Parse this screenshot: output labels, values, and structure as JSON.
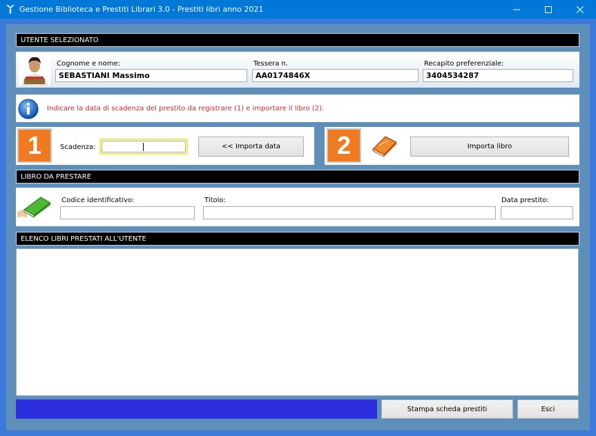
{
  "window": {
    "title": "Gestione Biblioteca e Prestiti Librari 3.0 - Prestiti libri anno 2021"
  },
  "user_section": {
    "header": "UTENTE SELEZIONATO",
    "name_label": "Cognome e nome:",
    "name_value": "SEBASTIANI Massimo",
    "card_label": "Tessera n.",
    "card_value": "AA0174846X",
    "contact_label": "Recapito preferenziale:",
    "contact_value": "3404534287"
  },
  "info": {
    "message": "Indicare la data di scadenza del prestito da registrare (1) e importare il libro (2)."
  },
  "step1": {
    "number": "1",
    "deadline_label": "Scadenza:",
    "deadline_value": "",
    "import_date_button": "<<  Importa data"
  },
  "step2": {
    "number": "2",
    "import_book_button": "Importa libro"
  },
  "book_section": {
    "header": "LIBRO DA PRESTARE",
    "code_label": "Codice identificativo:",
    "code_value": "",
    "title_label": "Titolo:",
    "title_value": "",
    "date_label": "Data prestito:",
    "date_value": ""
  },
  "loans_section": {
    "header": "ELENCO LIBRI PRESTATI ALL'UTENTE"
  },
  "footer": {
    "print_button": "Stampa scheda prestiti",
    "exit_button": "Esci"
  },
  "colors": {
    "titlebar": "#0078d7",
    "panel_bg": "#5d8fba",
    "accent_orange": "#f07a22",
    "info_text": "#cc2a2a",
    "progress_bar": "#2d2ede",
    "deadline_focus_border": "#f0f040"
  },
  "icons": [
    "app-icon",
    "minimize-icon",
    "maximize-icon",
    "close-icon",
    "user-avatar",
    "info-icon",
    "orange-book-icon",
    "green-book-icon"
  ]
}
